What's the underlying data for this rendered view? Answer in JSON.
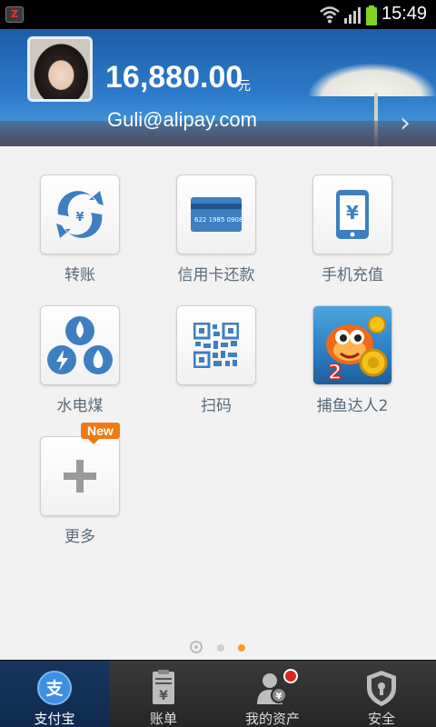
{
  "status_bar": {
    "time": "15:49",
    "notification_badge": "Z"
  },
  "header": {
    "balance": "16,880.00",
    "currency_unit": "元",
    "email": "Guli@alipay.com",
    "arrow": "›"
  },
  "apps": [
    {
      "label": "转账",
      "icon": "transfer-icon"
    },
    {
      "label": "信用卡还款",
      "icon": "credit-card-icon",
      "card_number": "622 1985 0908"
    },
    {
      "label": "手机充值",
      "icon": "mobile-recharge-icon",
      "symbol": "¥"
    },
    {
      "label": "水电煤",
      "icon": "utilities-icon"
    },
    {
      "label": "扫码",
      "icon": "qr-code-icon"
    },
    {
      "label": "捕鱼达人2",
      "icon": "fishing-game-icon",
      "game_badge": "2"
    },
    {
      "label": "更多",
      "icon": "plus-icon",
      "badge": "New"
    }
  ],
  "pager": {
    "page_count": 2,
    "active_page": 2
  },
  "tabs": [
    {
      "label": "支付宝",
      "icon": "alipay-icon",
      "active": true,
      "icon_glyph": "支"
    },
    {
      "label": "账单",
      "icon": "bill-icon",
      "active": false,
      "icon_glyph": "¥"
    },
    {
      "label": "我的资产",
      "icon": "assets-icon",
      "active": false,
      "icon_glyph": "¥"
    },
    {
      "label": "安全",
      "icon": "shield-icon",
      "active": false
    }
  ],
  "colors": {
    "accent": "#2c7ac9",
    "icon_blue": "#3d7fc1",
    "badge_orange": "#f07a12",
    "active_dot": "#f2a02a"
  }
}
